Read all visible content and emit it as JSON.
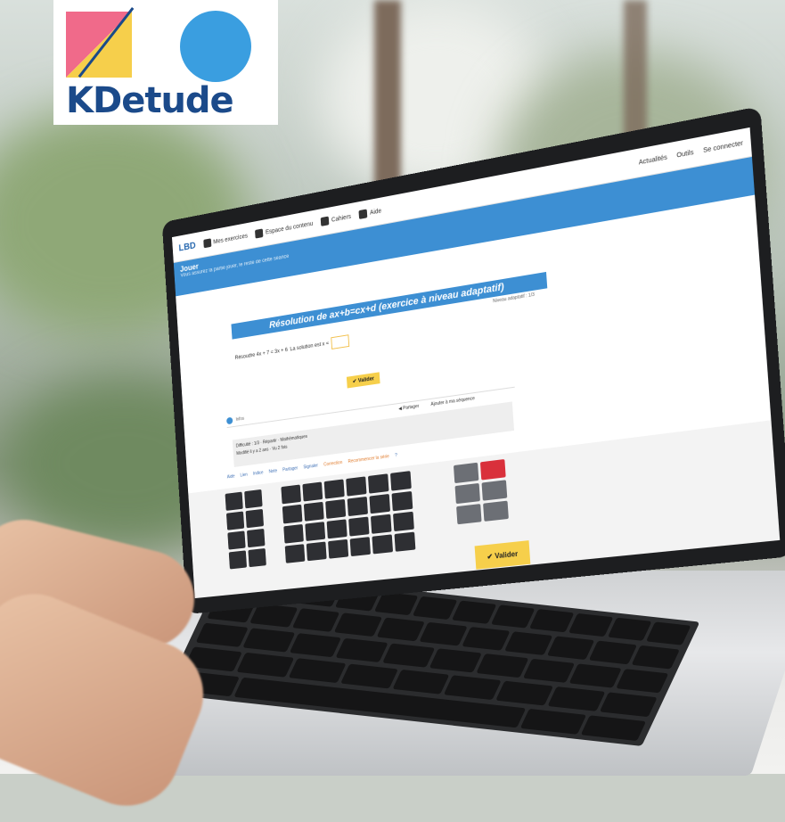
{
  "logo": {
    "text": "KDetude",
    "colors": {
      "pink": "#f06a8a",
      "yellow": "#f6cf4b",
      "blue_circle": "#3a9ee0",
      "text": "#1b4a8a"
    }
  },
  "app": {
    "brand": "LBD",
    "nav": [
      "Mes exercices",
      "Espace du contenu",
      "Cahiers",
      "Aide"
    ],
    "right_nav": [
      "Actualités",
      "Outils",
      "Se connecter"
    ],
    "header_title": "Jouer",
    "header_subtitle": "Vous assurez la partie jouer, le reste de cette séance",
    "exercise_title": "Résolution de ax+b=cx+d (exercice à niveau adaptatif)",
    "exercise_note": "Niveau adaptatif : 1/3",
    "question_prefix": "Résoudre 4x + 7 = 3x + 6",
    "question_suffix": "La solution est x =",
    "validate_small": "✔ Valider",
    "info_text": "Infos",
    "actions": [
      "◀ Partager",
      "Ajouter à ma séquence"
    ],
    "meta_line1": "Difficulté : 1/3 · Répartir · Mathématiques",
    "meta_line2": "Modifié il y a 2 ans · Vu 2 fois",
    "links": [
      "Aide",
      "Lien",
      "Indice",
      "Note",
      "Partager",
      "Signaler",
      "Correction",
      "Recommencer la série",
      "?"
    ],
    "validate_big": "✔ Valider"
  },
  "colors": {
    "accent_blue": "#3d8fd3",
    "validate_yellow": "#f6cf4b",
    "delete_red": "#d9303b",
    "key_dark": "#2e2f33"
  }
}
